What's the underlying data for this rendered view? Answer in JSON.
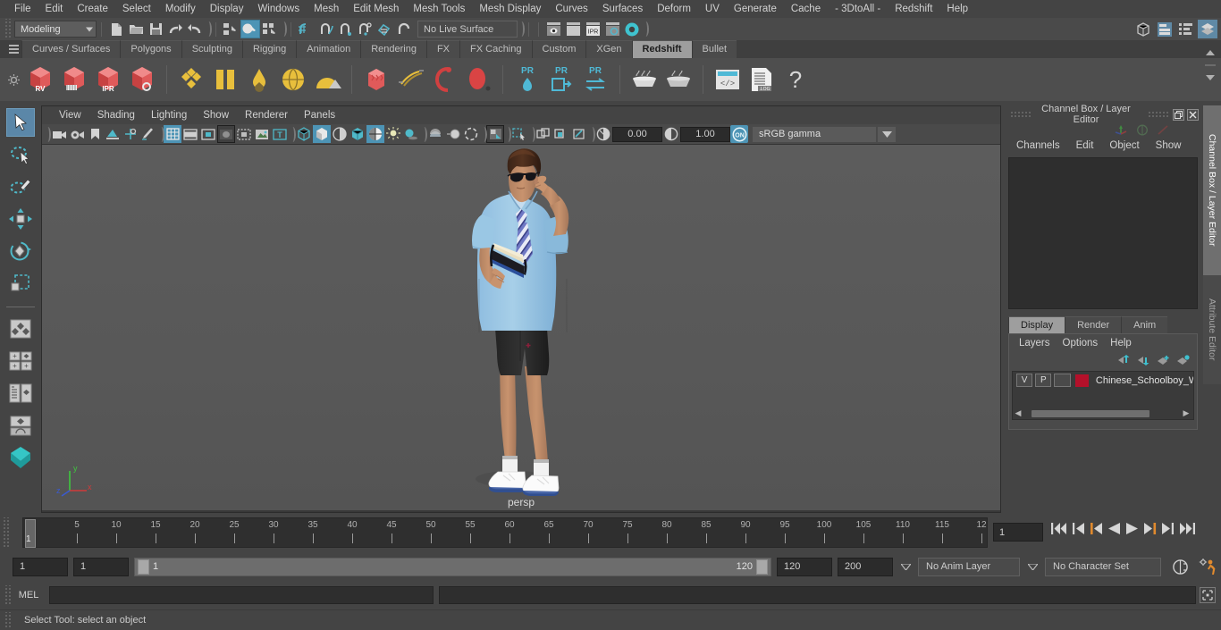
{
  "app": {
    "title": "Autodesk Maya",
    "scene_character": "Chinese_Schoolboy_Walk"
  },
  "menubar": {
    "items": [
      {
        "label": "File"
      },
      {
        "label": "Edit"
      },
      {
        "label": "Create"
      },
      {
        "label": "Select"
      },
      {
        "label": "Modify"
      },
      {
        "label": "Display"
      },
      {
        "label": "Windows"
      },
      {
        "label": "Mesh"
      },
      {
        "label": "Edit Mesh"
      },
      {
        "label": "Mesh Tools"
      },
      {
        "label": "Mesh Display"
      },
      {
        "label": "Curves"
      },
      {
        "label": "Surfaces"
      },
      {
        "label": "Deform"
      },
      {
        "label": "UV"
      },
      {
        "label": "Generate"
      },
      {
        "label": "Cache"
      },
      {
        "label": "- 3DtoAll -"
      },
      {
        "label": "Redshift"
      },
      {
        "label": "Help"
      }
    ]
  },
  "statusbar": {
    "menu_set": "Modeling",
    "live_surface": "No Live Surface",
    "icons": [
      "new-scene-icon",
      "open-scene-icon",
      "save-scene-icon",
      "undo-icon",
      "redo-icon",
      "select-hierarchy-icon",
      "select-object-icon",
      "select-component-icon",
      "snap-grid-icon",
      "snap-curve-icon",
      "snap-point-icon",
      "snap-projected-center-icon",
      "snap-view-plane-icon",
      "make-live-icon",
      "render-view-icon",
      "render-sequence-icon",
      "ipr-render-icon",
      "render-settings-icon",
      "hypershade-icon"
    ],
    "right_icons": [
      "show-hide-modeling-toolkit-icon",
      "show-hide-attribute-editor-icon",
      "show-hide-tool-settings-icon",
      "show-hide-channel-box-icon"
    ]
  },
  "shelf": {
    "tabs": [
      {
        "label": "Curves / Surfaces",
        "selected": false
      },
      {
        "label": "Polygons",
        "selected": false
      },
      {
        "label": "Sculpting",
        "selected": false
      },
      {
        "label": "Rigging",
        "selected": false
      },
      {
        "label": "Animation",
        "selected": false
      },
      {
        "label": "Rendering",
        "selected": false
      },
      {
        "label": "FX",
        "selected": false
      },
      {
        "label": "FX Caching",
        "selected": false
      },
      {
        "label": "Custom",
        "selected": false
      },
      {
        "label": "XGen",
        "selected": false
      },
      {
        "label": "Redshift",
        "selected": true
      },
      {
        "label": "Bullet",
        "selected": false
      }
    ],
    "buttons": [
      "redshift-render-view-icon",
      "redshift-render-sequence-icon",
      "redshift-ipr-icon",
      "redshift-render-settings-icon",
      "redshift-material-icon",
      "redshift-material-blender-icon",
      "redshift-incandescent-icon",
      "redshift-sub-surface-icon",
      "redshift-matte-icon",
      "redshift-proxy-icon",
      "redshift-hair-icon",
      "redshift-curve-icon",
      "redshift-sphere-icon",
      "redshift-pr-light-icon",
      "redshift-pr-portal-icon",
      "redshift-pr-converter-icon",
      "redshift-bake-icon",
      "redshift-bake-set-icon",
      "redshift-script-icon",
      "redshift-log-icon",
      "redshift-help-icon"
    ]
  },
  "tool_shelf": {
    "tools": [
      {
        "name": "select-tool",
        "selected": true
      },
      {
        "name": "lasso-select-tool",
        "selected": false
      },
      {
        "name": "paint-select-tool",
        "selected": false
      },
      {
        "name": "move-tool",
        "selected": false
      },
      {
        "name": "rotate-tool",
        "selected": false
      },
      {
        "name": "scale-tool",
        "selected": false
      },
      {
        "name": "last-tool-used",
        "selected": false
      },
      {
        "name": "four-view-layout",
        "selected": false
      },
      {
        "name": "persp-outliner-layout",
        "selected": false
      },
      {
        "name": "persp-graph-layout",
        "selected": false
      },
      {
        "name": "single-perspective-view",
        "selected": false
      },
      {
        "name": "quick-rig-icon",
        "selected": false
      }
    ]
  },
  "viewport": {
    "menu": [
      {
        "label": "View"
      },
      {
        "label": "Shading"
      },
      {
        "label": "Lighting"
      },
      {
        "label": "Show"
      },
      {
        "label": "Renderer"
      },
      {
        "label": "Panels"
      }
    ],
    "exposure": "0.00",
    "gamma": "1.00",
    "color_management": "sRGB gamma",
    "camera_label": "persp",
    "axis": {
      "x": "x",
      "y": "y",
      "z": "z"
    },
    "toolbar_icons": [
      "select-camera-icon",
      "camera-attributes-icon",
      "bookmark-icon",
      "image-plane-icon",
      "two-dimensional-pan-zoom-icon",
      "grease-pencil-icon",
      "grid-toggle-icon",
      "film-gate-icon",
      "resolution-gate-icon",
      "gate-mask-icon",
      "film-origin-icon",
      "safe-action-icon",
      "text-overlay-icon",
      "wireframe-icon",
      "smooth-shade-all-icon",
      "shaded-wireframe-icon",
      "use-default-material-icon",
      "textured-icon",
      "use-all-lights-icon",
      "shadows-icon",
      "screen-space-ambient-occlusion-icon",
      "motion-blur-icon",
      "multisample-icon",
      "isolate-select-icon",
      "xray-icon",
      "xray-joints-icon",
      "xray-active-components-icon",
      "exposure-icon",
      "gamma-icon",
      "color-management-toggle-icon"
    ]
  },
  "channel_box": {
    "title": "Channel Box / Layer Editor",
    "window_buttons": [
      "restore-icon",
      "close-icon"
    ],
    "menu": [
      {
        "label": "Channels"
      },
      {
        "label": "Edit"
      },
      {
        "label": "Object"
      },
      {
        "label": "Show"
      }
    ]
  },
  "layer_editor": {
    "tabs": [
      {
        "label": "Display",
        "selected": true
      },
      {
        "label": "Render",
        "selected": false
      },
      {
        "label": "Anim",
        "selected": false
      }
    ],
    "menu": [
      {
        "label": "Layers"
      },
      {
        "label": "Options"
      },
      {
        "label": "Help"
      }
    ],
    "buttons": [
      "move-layer-up-icon",
      "move-layer-down-icon",
      "create-new-layer-icon",
      "create-layer-from-selected-icon"
    ],
    "layers": [
      {
        "visibility": "V",
        "playback": "P",
        "shading": "",
        "color": "#b4102a",
        "name": "Chinese_Schoolboy_W"
      }
    ]
  },
  "side_tabs": [
    {
      "label": "Channel Box / Layer Editor",
      "selected": true
    },
    {
      "label": "Attribute Editor",
      "selected": false
    }
  ],
  "timeline": {
    "start_visible": 1,
    "ticks": [
      5,
      10,
      15,
      20,
      25,
      30,
      35,
      40,
      45,
      50,
      55,
      60,
      65,
      70,
      75,
      80,
      85,
      90,
      95,
      100,
      105,
      110,
      115,
      120
    ],
    "tick_labels": [
      "5",
      "10",
      "15",
      "20",
      "25",
      "30",
      "35",
      "40",
      "45",
      "50",
      "55",
      "60",
      "65",
      "70",
      "75",
      "80",
      "85",
      "90",
      "95",
      "100",
      "105",
      "110",
      "115",
      "12"
    ],
    "current_frame_marker": "1",
    "current_frame_field": "1",
    "transport": [
      "go-to-start-icon",
      "step-back-keyframe-icon",
      "step-back-frame-icon",
      "play-backwards-icon",
      "play-forwards-icon",
      "step-forward-frame-icon",
      "step-forward-keyframe-icon",
      "go-to-end-icon"
    ]
  },
  "range_slider": {
    "anim_start": "1",
    "range_start": "1",
    "bar_start_label": "1",
    "bar_end_label": "120",
    "range_end": "120",
    "anim_end": "200",
    "anim_layer": "No Anim Layer",
    "character_set": "No Character Set",
    "right_icons": [
      "auto-keyframe-toggle-icon",
      "animation-preferences-icon"
    ]
  },
  "command_line": {
    "language": "MEL",
    "input_value": "",
    "input_placeholder": "",
    "output_value": "",
    "script-editor-button": "script-editor-icon"
  },
  "status_line": {
    "message": "Select Tool: select an object"
  },
  "colors": {
    "accent_blue": "#4d94b5",
    "shelf_tab_selected": "#9e9e9e",
    "layer_swatch": "#b4102a",
    "panel_bg": "#444444",
    "viewport_bg": "#585858"
  }
}
